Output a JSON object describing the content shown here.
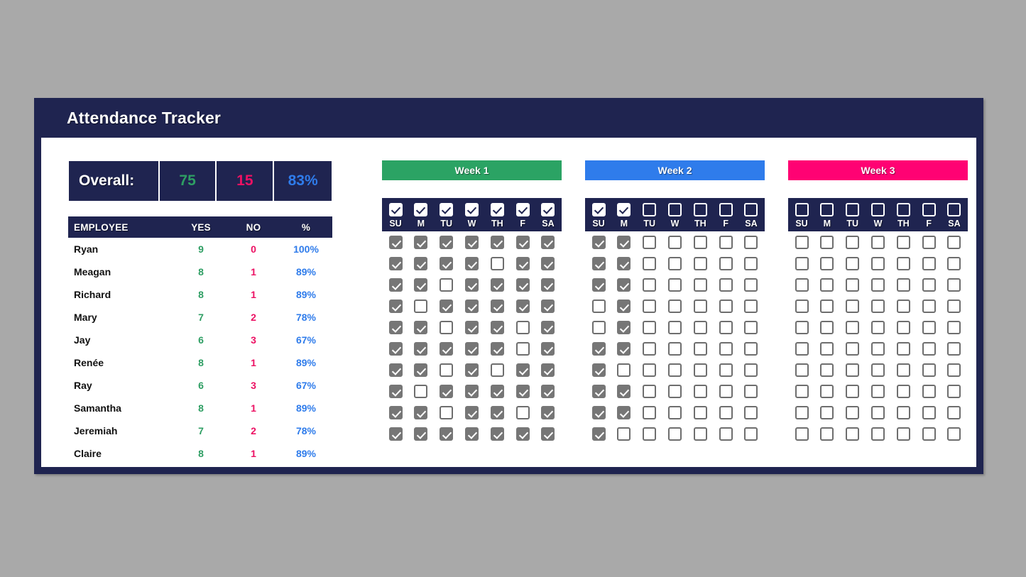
{
  "header": {
    "title": "Attendance Tracker"
  },
  "summary": {
    "label": "Overall:",
    "yes": "75",
    "no": "15",
    "percent": "83%"
  },
  "table": {
    "columns": [
      "EMPLOYEE",
      "YES",
      "NO",
      "%"
    ],
    "rows": [
      {
        "name": "Ryan",
        "yes": "9",
        "no": "0",
        "pct": "100%"
      },
      {
        "name": "Meagan",
        "yes": "8",
        "no": "1",
        "pct": "89%"
      },
      {
        "name": "Richard",
        "yes": "8",
        "no": "1",
        "pct": "89%"
      },
      {
        "name": "Mary",
        "yes": "7",
        "no": "2",
        "pct": "78%"
      },
      {
        "name": "Jay",
        "yes": "6",
        "no": "3",
        "pct": "67%"
      },
      {
        "name": "Renée",
        "yes": "8",
        "no": "1",
        "pct": "89%"
      },
      {
        "name": "Ray",
        "yes": "6",
        "no": "3",
        "pct": "67%"
      },
      {
        "name": "Samantha",
        "yes": "8",
        "no": "1",
        "pct": "89%"
      },
      {
        "name": "Jeremiah",
        "yes": "7",
        "no": "2",
        "pct": "78%"
      },
      {
        "name": "Claire",
        "yes": "8",
        "no": "1",
        "pct": "89%"
      }
    ]
  },
  "day_labels": [
    "SU",
    "M",
    "TU",
    "W",
    "TH",
    "F",
    "SA"
  ],
  "weeks": [
    {
      "label": "Week 1",
      "color": "#2ba364",
      "header_checks": [
        true,
        true,
        true,
        true,
        true,
        true,
        true
      ],
      "rows": [
        [
          true,
          true,
          true,
          true,
          true,
          true,
          true
        ],
        [
          true,
          true,
          true,
          true,
          false,
          true,
          true
        ],
        [
          true,
          true,
          false,
          true,
          true,
          true,
          true
        ],
        [
          true,
          false,
          true,
          true,
          true,
          true,
          true
        ],
        [
          true,
          true,
          false,
          true,
          true,
          false,
          true
        ],
        [
          true,
          true,
          true,
          true,
          true,
          false,
          true
        ],
        [
          true,
          true,
          false,
          true,
          false,
          true,
          true
        ],
        [
          true,
          false,
          true,
          true,
          true,
          true,
          true
        ],
        [
          true,
          true,
          false,
          true,
          true,
          false,
          true
        ],
        [
          true,
          true,
          true,
          true,
          true,
          true,
          true
        ]
      ]
    },
    {
      "label": "Week 2",
      "color": "#2f7ceb",
      "header_checks": [
        true,
        true,
        false,
        false,
        false,
        false,
        false
      ],
      "rows": [
        [
          true,
          true,
          false,
          false,
          false,
          false,
          false
        ],
        [
          true,
          true,
          false,
          false,
          false,
          false,
          false
        ],
        [
          true,
          true,
          false,
          false,
          false,
          false,
          false
        ],
        [
          false,
          true,
          false,
          false,
          false,
          false,
          false
        ],
        [
          false,
          true,
          false,
          false,
          false,
          false,
          false
        ],
        [
          true,
          true,
          false,
          false,
          false,
          false,
          false
        ],
        [
          true,
          false,
          false,
          false,
          false,
          false,
          false
        ],
        [
          true,
          true,
          false,
          false,
          false,
          false,
          false
        ],
        [
          true,
          true,
          false,
          false,
          false,
          false,
          false
        ],
        [
          true,
          false,
          false,
          false,
          false,
          false,
          false
        ]
      ]
    },
    {
      "label": "Week 3",
      "color": "#ff0273",
      "header_checks": [
        false,
        false,
        false,
        false,
        false,
        false,
        false
      ],
      "rows": [
        [
          false,
          false,
          false,
          false,
          false,
          false,
          false
        ],
        [
          false,
          false,
          false,
          false,
          false,
          false,
          false
        ],
        [
          false,
          false,
          false,
          false,
          false,
          false,
          false
        ],
        [
          false,
          false,
          false,
          false,
          false,
          false,
          false
        ],
        [
          false,
          false,
          false,
          false,
          false,
          false,
          false
        ],
        [
          false,
          false,
          false,
          false,
          false,
          false,
          false
        ],
        [
          false,
          false,
          false,
          false,
          false,
          false,
          false
        ],
        [
          false,
          false,
          false,
          false,
          false,
          false,
          false
        ],
        [
          false,
          false,
          false,
          false,
          false,
          false,
          false
        ],
        [
          false,
          false,
          false,
          false,
          false,
          false,
          false
        ]
      ]
    }
  ]
}
